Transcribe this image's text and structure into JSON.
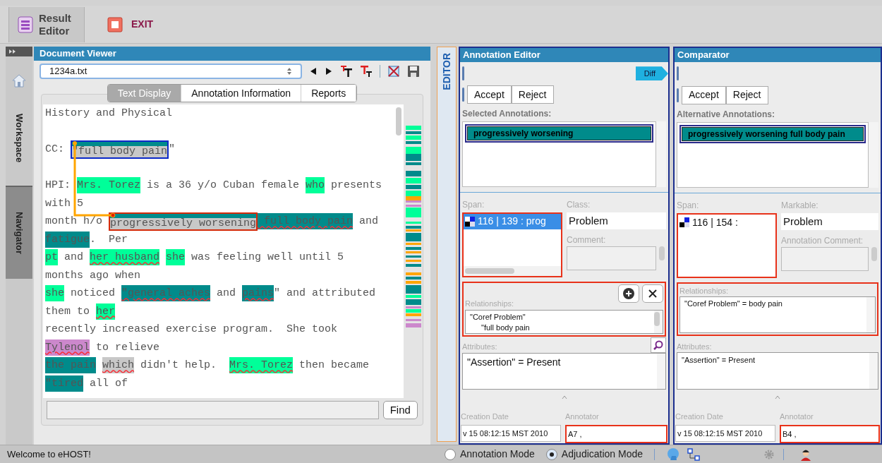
{
  "toolbar": {
    "buttons": [
      {
        "label": "Result Editor",
        "kind": "editor"
      },
      {
        "label": "EXIT",
        "kind": "exit"
      }
    ]
  },
  "sidebar": {
    "tabs": [
      {
        "label": "Workspace",
        "selected": true
      },
      {
        "label": "Navigator",
        "selected": false
      }
    ]
  },
  "document_viewer": {
    "title": "Document Viewer",
    "file": "1234a.txt",
    "tabs": [
      {
        "label": "Text Display",
        "selected": true
      },
      {
        "label": "Annotation Information",
        "selected": false
      },
      {
        "label": "Reports",
        "selected": false
      }
    ],
    "lines": [
      {
        "kind": "text",
        "segments": [
          {
            "kind": "plain",
            "text": "History and Physical"
          }
        ]
      },
      {
        "kind": "blank"
      },
      {
        "kind": "text",
        "segments": [
          {
            "kind": "plain",
            "text": "CC: "
          },
          {
            "kind": "framed",
            "text": "\"full body pain",
            "color": "#0a28c8"
          },
          {
            "kind": "plain",
            "text": "\""
          }
        ]
      },
      {
        "kind": "blank"
      },
      {
        "kind": "text",
        "segments": [
          {
            "kind": "plain",
            "text": "HPI: "
          },
          {
            "kind": "highlight",
            "text": "Mrs. Torez",
            "color": "#00ff99"
          },
          {
            "kind": "plain",
            "text": " is a 36 y/o Cuban female "
          },
          {
            "kind": "highlight",
            "text": "who",
            "color": "#00ff99"
          },
          {
            "kind": "plain",
            "text": " presents"
          }
        ]
      },
      {
        "kind": "text",
        "segments": [
          {
            "kind": "plain",
            "text": "with 5"
          }
        ]
      },
      {
        "kind": "text",
        "segments": [
          {
            "kind": "plain",
            "text": "month h/o "
          },
          {
            "kind": "framed",
            "text": "progressively worsening",
            "color": "#d42a0a"
          },
          {
            "kind": "highlight",
            "text": " full body pain",
            "color": "#008b8b",
            "underlined": true
          },
          {
            "kind": "plain",
            "text": " and"
          }
        ]
      },
      {
        "kind": "text",
        "segments": [
          {
            "kind": "highlight",
            "text": "fatigue",
            "color": "#008b8b"
          },
          {
            "kind": "plain",
            "text": ".  Per"
          }
        ]
      },
      {
        "kind": "text",
        "segments": [
          {
            "kind": "highlight",
            "text": "pt",
            "color": "#00ff99"
          },
          {
            "kind": "plain",
            "text": " and "
          },
          {
            "kind": "highlight",
            "text": "her husband",
            "color": "#00ff99",
            "underlined": true,
            "space_after": true
          },
          {
            "kind": "highlight",
            "text": "she",
            "color": "#00ff99"
          },
          {
            "kind": "plain",
            "text": " was feeling well until 5"
          }
        ]
      },
      {
        "kind": "text",
        "segments": [
          {
            "kind": "plain",
            "text": "months ago when"
          }
        ]
      },
      {
        "kind": "text",
        "segments": [
          {
            "kind": "highlight",
            "text": "she",
            "color": "#00ff99"
          },
          {
            "kind": "plain",
            "text": " noticed "
          },
          {
            "kind": "highlight",
            "text": "\"general aches",
            "color": "#008b8b",
            "underlined": true
          },
          {
            "kind": "plain",
            "text": " and "
          },
          {
            "kind": "highlight",
            "text": "pains",
            "color": "#008b8b",
            "underlined": true
          },
          {
            "kind": "plain",
            "text": "\" and attributed"
          }
        ]
      },
      {
        "kind": "text",
        "segments": [
          {
            "kind": "plain",
            "text": "them to "
          },
          {
            "kind": "highlight",
            "text": "her",
            "color": "#00ff99",
            "underlined": true
          }
        ]
      },
      {
        "kind": "text",
        "segments": [
          {
            "kind": "plain",
            "text": "recently increased exercise program.  She took"
          }
        ]
      },
      {
        "kind": "text",
        "segments": [
          {
            "kind": "highlight",
            "text": "Tylenol",
            "color": "#cc88cc",
            "underlined": true
          },
          {
            "kind": "plain",
            "text": " to relieve"
          }
        ]
      },
      {
        "kind": "text",
        "segments": [
          {
            "kind": "highlight",
            "text": "the pain",
            "color": "#008b8b",
            "space_after": true
          },
          {
            "kind": "highlight",
            "text": "which",
            "color": "#c8c8c8",
            "underlined": true
          },
          {
            "kind": "plain",
            "text": " didn't help.  "
          },
          {
            "kind": "highlight",
            "text": "Mrs. Torez",
            "color": "#00ff99",
            "underlined": true
          },
          {
            "kind": "plain",
            "text": " then became"
          }
        ]
      },
      {
        "kind": "text",
        "segments": [
          {
            "kind": "highlight",
            "text": "\"tired",
            "color": "#008b8b"
          },
          {
            "kind": "plain",
            "text": " all of"
          }
        ]
      }
    ],
    "find_button": "Find"
  },
  "editor_tab": "EDITOR",
  "annotation_editor": {
    "kind": "editor",
    "title": "Annotation Editor",
    "diff_button": "Diff",
    "buttons": [
      "Accept",
      "Reject"
    ],
    "list_label": "Selected Annotations:",
    "annotations": [
      {
        "text": "progressively worsening",
        "selected": true
      }
    ],
    "span": {
      "label": "Span:",
      "flagged": true,
      "items": [
        {
          "text": "116 | 139 : prog",
          "selected": true
        }
      ]
    },
    "class": {
      "label": "Class:",
      "value": "Problem"
    },
    "comment": {
      "label": "Comment:"
    },
    "relationships": {
      "label": "Relationships:",
      "flagged": true,
      "items": [
        {
          "text": "\"Coref Problem\"",
          "children": [
            {
              "text": "\"full body pain"
            }
          ]
        }
      ]
    },
    "attributes": {
      "label": "Attributes:",
      "items": [
        "\"Assertion\" = Present"
      ]
    },
    "creation_date": {
      "label": "Creation Date",
      "value": "v 15 08:12:15 MST 2010"
    },
    "annotator": {
      "label": "Annotator",
      "value": "A7 ,",
      "flagged": true
    }
  },
  "comparator": {
    "kind": "comparator",
    "title": "Comparator",
    "buttons": [
      "Accept",
      "Reject"
    ],
    "list_label": "Alternative Annotations:",
    "annotations": [
      {
        "text": "progressively worsening full body pain",
        "selected": true
      }
    ],
    "span": {
      "label": "Span:",
      "flagged": true,
      "items": [
        {
          "text": "116 | 154 :",
          "selected": false
        }
      ]
    },
    "class": {
      "label": "Markable:",
      "value": "Problem"
    },
    "comment": {
      "label": "Annotation Comment:"
    },
    "relationships": {
      "label": "Relationships:",
      "flagged": true,
      "items": [
        {
          "text": "\"Coref Problem\" = body pain"
        }
      ]
    },
    "attributes": {
      "label": "Attributes:",
      "items": [
        "\"Assertion\" = Present"
      ]
    },
    "creation_date": {
      "label": "Creation Date",
      "value": "v 15 08:12:15 MST 2010"
    },
    "annotator": {
      "label": "Annotator",
      "value": "B4 ,",
      "flagged": true
    }
  },
  "status_bar": {
    "message": "Welcome to eHOST!",
    "modes": [
      {
        "label": "Annotation Mode",
        "selected": false
      },
      {
        "label": "Adjudication Mode",
        "selected": true
      }
    ]
  }
}
